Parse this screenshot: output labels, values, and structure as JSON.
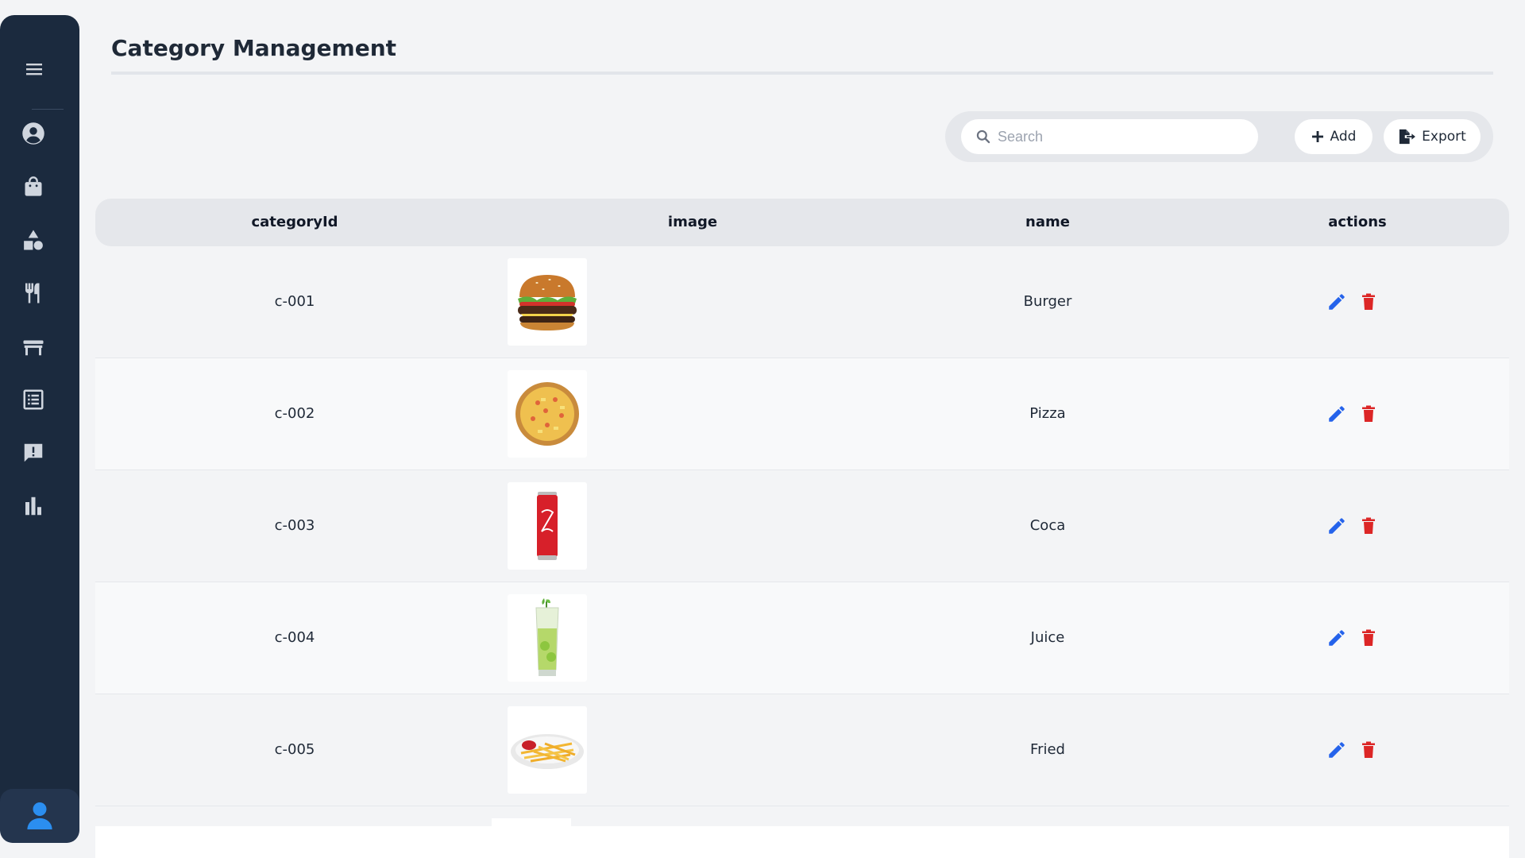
{
  "page": {
    "title": "Category Management"
  },
  "sidebar": {
    "items": [
      {
        "icon": "account-circle-icon"
      },
      {
        "icon": "shopping-bag-icon"
      },
      {
        "icon": "category-shapes-icon"
      },
      {
        "icon": "restaurant-icon"
      },
      {
        "icon": "table-icon"
      },
      {
        "icon": "list-icon"
      },
      {
        "icon": "feedback-icon"
      },
      {
        "icon": "bar-chart-icon"
      }
    ],
    "profile_icon": "person-icon"
  },
  "toolbar": {
    "search_placeholder": "Search",
    "add_label": "Add",
    "export_label": "Export"
  },
  "table": {
    "headers": [
      "categoryId",
      "image",
      "name",
      "actions"
    ],
    "rows": [
      {
        "id": "c-001",
        "name": "Burger",
        "image": "burger"
      },
      {
        "id": "c-002",
        "name": "Pizza",
        "image": "pizza"
      },
      {
        "id": "c-003",
        "name": "Coca",
        "image": "coca"
      },
      {
        "id": "c-004",
        "name": "Juice",
        "image": "juice"
      },
      {
        "id": "c-005",
        "name": "Fried",
        "image": "fries"
      }
    ]
  },
  "colors": {
    "sidebar_bg": "#1b2a3e",
    "accent_blue": "#2563eb",
    "delete_red": "#dc2626",
    "profile_blue": "#2b8ef0"
  }
}
